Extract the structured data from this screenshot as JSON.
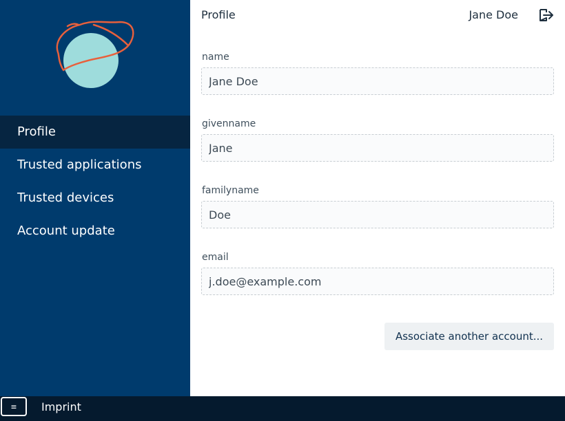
{
  "sidebar": {
    "items": [
      {
        "label": "Profile",
        "active": true
      },
      {
        "label": "Trusted applications",
        "active": false
      },
      {
        "label": "Trusted devices",
        "active": false
      },
      {
        "label": "Account update",
        "active": false
      }
    ]
  },
  "header": {
    "title": "Profile",
    "user_name": "Jane Doe",
    "logout_icon": "logout-icon"
  },
  "form": {
    "fields": [
      {
        "label": "name",
        "value": "Jane Doe"
      },
      {
        "label": "givenname",
        "value": "Jane"
      },
      {
        "label": "familyname",
        "value": "Doe"
      },
      {
        "label": "email",
        "value": "j.doe@example.com"
      }
    ],
    "associate_button": "Associate another account..."
  },
  "footer": {
    "menu_icon": "≡",
    "imprint": "Imprint"
  },
  "colors": {
    "sidebar_bg": "#003b6d",
    "sidebar_active": "#062541",
    "footer_bg": "#051a2e",
    "logo_circle": "#9edcdc",
    "logo_stroke": "#e8603c"
  }
}
